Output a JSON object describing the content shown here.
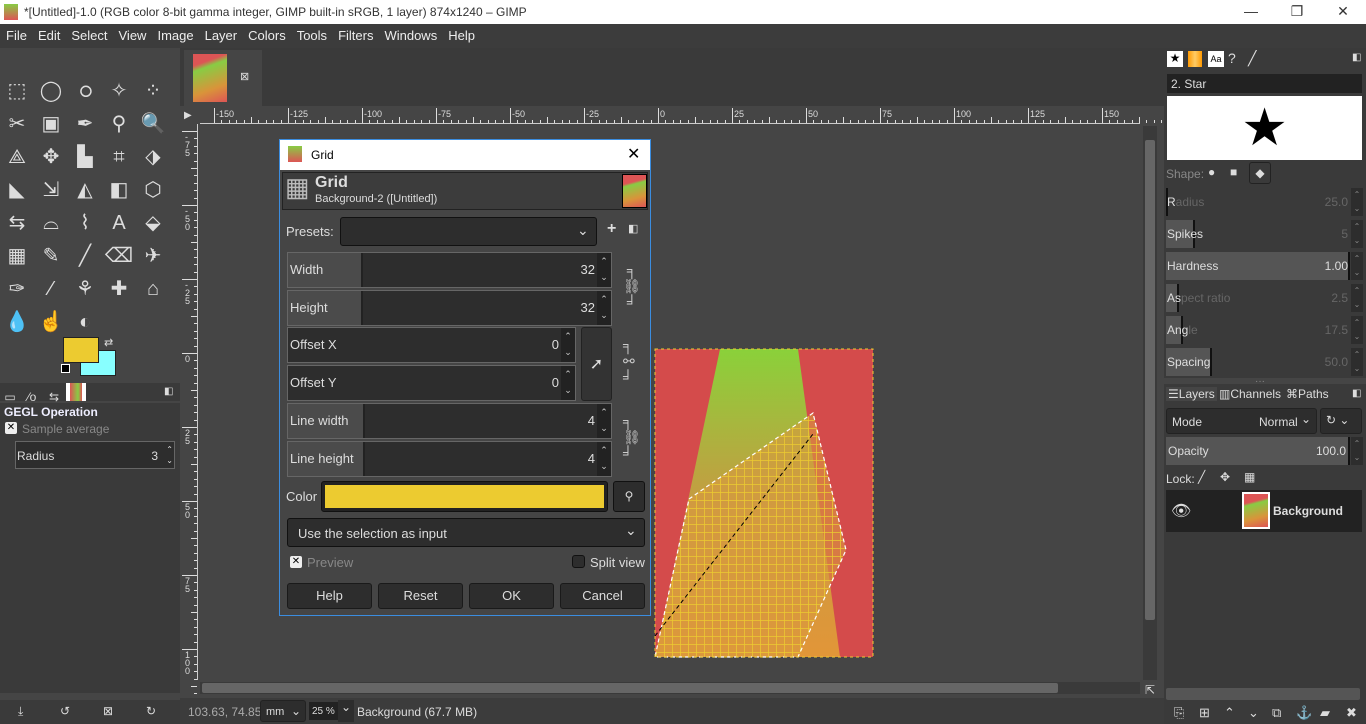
{
  "window": {
    "title": "*[Untitled]-1.0 (RGB color 8-bit gamma integer, GIMP built-in sRGB, 1 layer) 874x1240 – GIMP",
    "minimize": "—",
    "restore": "❐",
    "close": "✕"
  },
  "menu": [
    "File",
    "Edit",
    "Select",
    "View",
    "Image",
    "Layer",
    "Colors",
    "Tools",
    "Filters",
    "Windows",
    "Help"
  ],
  "toolbox": {
    "icons": [
      "rect-select",
      "ellipse-select",
      "free-select",
      "fuzzy-select",
      "by-color-select",
      "scissors",
      "foreground-select",
      "paths",
      "color-picker",
      "zoom",
      "measure",
      "move",
      "align",
      "crop",
      "unified-transform",
      "warp",
      "handle-transform",
      "shear",
      "perspective",
      "3d-transform",
      "flip",
      "cage",
      "warp-transform",
      "text",
      "bucket-fill",
      "gradient",
      "pencil",
      "paintbrush",
      "eraser",
      "airbrush",
      "ink",
      "mypaint",
      "clone",
      "heal",
      "perspective-clone",
      "blur",
      "smudge",
      "dodge-burn"
    ],
    "glyphs": [
      "⬚",
      "◯",
      "ഠ",
      "✧",
      "⁘",
      "✂",
      "▣",
      "✒",
      "⚲",
      "🔍",
      "⟁",
      "✥",
      "▙",
      "⌗",
      "⬗",
      "◣",
      "⇲",
      "◭",
      "◧",
      "⬡",
      "⇆",
      "⌓",
      "⌇",
      "A",
      "⬙",
      "▦",
      "✎",
      "╱",
      "⌫",
      "✈",
      "✑",
      "⁄",
      "⚘",
      "✚",
      "⌂",
      "💧",
      "☝",
      "◐"
    ],
    "fg_color": "#eccb30",
    "bg_color": "#88ffff"
  },
  "tool_options": {
    "heading": "GEGL Operation",
    "sample_average": "Sample average",
    "radius_label": "Radius",
    "radius_value": "3"
  },
  "ruler_h": [
    "-150",
    "-125",
    "-100",
    "-75",
    "-50",
    "-25",
    "0",
    "25",
    "50",
    "75",
    "100",
    "125",
    "150"
  ],
  "ruler_v": [
    "-75",
    "-50",
    "-25",
    "0",
    "25",
    "50",
    "75",
    "100"
  ],
  "status": {
    "coords": "103.63, 74.85",
    "unit": "mm",
    "zoom": "25 %",
    "info": "Background (67.7 MB)"
  },
  "dialog": {
    "title": "Grid",
    "heading": "Grid",
    "subheading": "Background-2 ([Untitled])",
    "presets_label": "Presets:",
    "presets_value": "",
    "width_label": "Width",
    "width": "32",
    "height_label": "Height",
    "height": "32",
    "offx_label": "Offset X",
    "offx": "0",
    "offy_label": "Offset Y",
    "offy": "0",
    "lw_label": "Line width",
    "lw": "4",
    "lh_label": "Line height",
    "lh": "4",
    "color_label": "Color",
    "color": "#eccb30",
    "input_mode": "Use the selection as input",
    "preview_label": "Preview",
    "preview_checked": true,
    "split_label": "Split view",
    "split_checked": false,
    "help": "Help",
    "reset": "Reset",
    "ok": "OK",
    "cancel": "Cancel"
  },
  "brushes": {
    "name": "2. Star",
    "shape_label": "Shape:",
    "sliders": [
      {
        "label": "Radius",
        "value": "25.0",
        "fraction": 0.01,
        "dim": true,
        "lit": "R"
      },
      {
        "label": "Spikes",
        "value": "5",
        "fraction": 0.16,
        "dim": true,
        "lit": "Spikes"
      },
      {
        "label": "Hardness",
        "value": "1.00",
        "fraction": 1.0,
        "dim": false,
        "lit": "Hardness"
      },
      {
        "label": "Aspect ratio",
        "value": "2.5",
        "fraction": 0.07,
        "dim": true,
        "lit": "As"
      },
      {
        "label": "Angle",
        "value": "17.5",
        "fraction": 0.09,
        "dim": true,
        "lit": "Ang"
      },
      {
        "label": "Spacing",
        "value": "50.0",
        "fraction": 0.25,
        "dim": true,
        "lit": "Spacing"
      }
    ]
  },
  "layers": {
    "tabs": [
      "Layers",
      "Channels",
      "Paths"
    ],
    "mode_label": "Mode",
    "mode_value": "Normal",
    "opacity_label": "Opacity",
    "opacity_value": "100.0",
    "lock_label": "Lock:",
    "layer_name": "Background"
  }
}
